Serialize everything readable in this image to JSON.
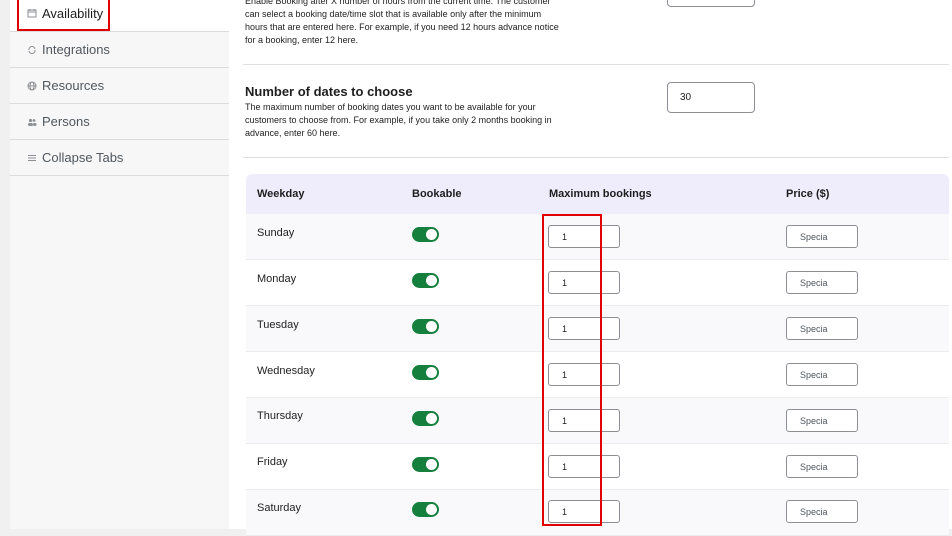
{
  "sidebar": {
    "items": [
      {
        "label": "Availability",
        "icon": "calendar-icon",
        "active": true
      },
      {
        "label": "Integrations",
        "icon": "sync-icon",
        "active": false
      },
      {
        "label": "Resources",
        "icon": "globe-icon",
        "active": false
      },
      {
        "label": "Persons",
        "icon": "people-icon",
        "active": false
      },
      {
        "label": "Collapse Tabs",
        "icon": "list-icon",
        "active": false
      }
    ]
  },
  "main": {
    "advance_notice": {
      "description": "Enable Booking after X number of hours from the current time. The customer can select a booking date/time slot that is available only after the minimum hours that are entered here. For example, if you need 12 hours advance notice for a booking, enter 12 here."
    },
    "dates_to_choose": {
      "title": "Number of dates to choose",
      "description": "The maximum number of booking dates you want to be available for your customers to choose from. For example, if you take only 2 months booking in advance, enter 60 here.",
      "value": "30"
    },
    "table": {
      "headers": {
        "weekday": "Weekday",
        "bookable": "Bookable",
        "max_bookings": "Maximum bookings",
        "price": "Price ($)"
      },
      "rows": [
        {
          "day": "Sunday",
          "bookable": true,
          "max": "1",
          "price_placeholder": "Specia"
        },
        {
          "day": "Monday",
          "bookable": true,
          "max": "1",
          "price_placeholder": "Specia"
        },
        {
          "day": "Tuesday",
          "bookable": true,
          "max": "1",
          "price_placeholder": "Specia"
        },
        {
          "day": "Wednesday",
          "bookable": true,
          "max": "1",
          "price_placeholder": "Specia"
        },
        {
          "day": "Thursday",
          "bookable": true,
          "max": "1",
          "price_placeholder": "Specia"
        },
        {
          "day": "Friday",
          "bookable": true,
          "max": "1",
          "price_placeholder": "Specia"
        },
        {
          "day": "Saturday",
          "bookable": true,
          "max": "1",
          "price_placeholder": "Specia"
        }
      ]
    }
  },
  "colors": {
    "highlight": "#e00000",
    "toggle_on": "#15803d",
    "table_header": "#efedfb"
  }
}
